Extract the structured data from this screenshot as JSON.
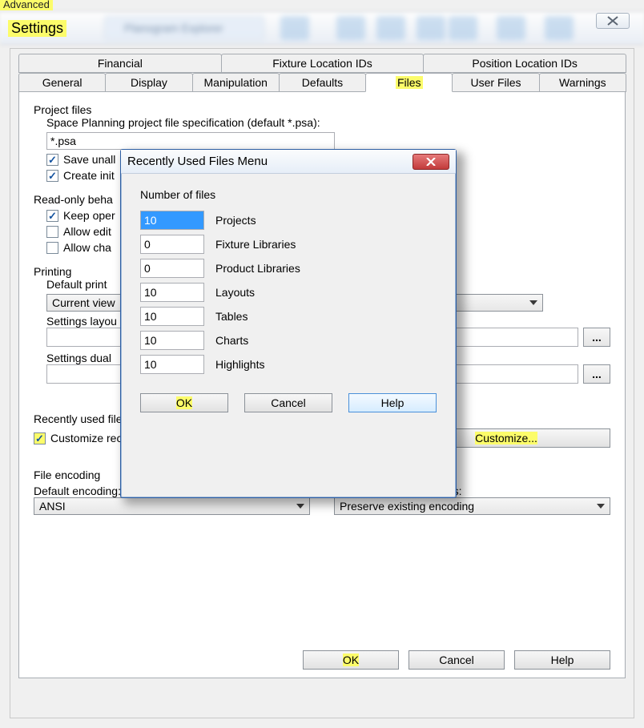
{
  "window": {
    "advanced_label": "Advanced",
    "title": "Settings",
    "bg_app": "Planogram Explorer"
  },
  "tabs_row1": [
    {
      "label": "Financial"
    },
    {
      "label": "Fixture Location IDs"
    },
    {
      "label": "Position Location IDs"
    }
  ],
  "tabs_row2": [
    {
      "label": "General"
    },
    {
      "label": "Display"
    },
    {
      "label": "Manipulation"
    },
    {
      "label": "Defaults"
    },
    {
      "label": "Files",
      "active": true
    },
    {
      "label": "User Files"
    },
    {
      "label": "Warnings"
    }
  ],
  "project_files": {
    "title": "Project files",
    "spec_label": "Space Planning project file specification (default *.psa):",
    "spec_value": "*.psa",
    "save_unallocated": {
      "checked": true,
      "label": "Save unall"
    },
    "create_initial": {
      "checked": true,
      "label": "Create init"
    }
  },
  "readonly": {
    "title": "Read-only beha",
    "keep_open": {
      "checked": true,
      "label": "Keep oper"
    },
    "allow_edit": {
      "checked": false,
      "label": "Allow edit"
    },
    "allow_change": {
      "checked": false,
      "label": "Allow cha"
    }
  },
  "printing": {
    "title": "Printing",
    "default_print_label": "Default print",
    "default_print_value": "Current view",
    "settings_layout_label": "Settings layou",
    "settings_layout_value": "",
    "settings_dual_label": "Settings dual",
    "settings_dual_value": "",
    "browse": "..."
  },
  "recent": {
    "title": "Recently used files",
    "customize_check": {
      "checked": true,
      "label": "Customize recently used files menu"
    },
    "customize_button": "Customize..."
  },
  "encoding": {
    "title": "File encoding",
    "default_label": "Default encoding:",
    "default_value": "ANSI",
    "save_label": "When saving project files:",
    "save_value": "Preserve existing encoding"
  },
  "buttons": {
    "ok": "OK",
    "cancel": "Cancel",
    "help": "Help"
  },
  "dialog": {
    "title": "Recently Used Files Menu",
    "group": "Number of files",
    "rows": [
      {
        "value": "10",
        "label": "Projects",
        "selected": true
      },
      {
        "value": "0",
        "label": "Fixture Libraries"
      },
      {
        "value": "0",
        "label": "Product Libraries"
      },
      {
        "value": "10",
        "label": "Layouts"
      },
      {
        "value": "10",
        "label": "Tables"
      },
      {
        "value": "10",
        "label": "Charts"
      },
      {
        "value": "10",
        "label": "Highlights"
      }
    ],
    "ok": "OK",
    "cancel": "Cancel",
    "help": "Help"
  }
}
